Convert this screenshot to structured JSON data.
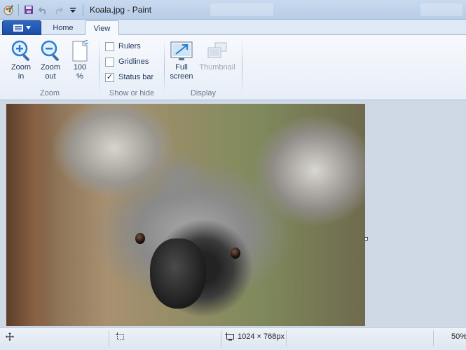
{
  "window": {
    "title": "Koala.jpg - Paint"
  },
  "tabs": {
    "home": "Home",
    "view": "View"
  },
  "ribbon": {
    "zoom": {
      "label": "Zoom",
      "zoom_in": "Zoom\nin",
      "zoom_out": "Zoom\nout",
      "hundred": "100\n%"
    },
    "show_or_hide": {
      "label": "Show or hide",
      "rulers": "Rulers",
      "gridlines": "Gridlines",
      "status_bar": "Status bar",
      "rulers_checked": false,
      "gridlines_checked": false,
      "status_bar_checked": true
    },
    "display": {
      "label": "Display",
      "full_screen": "Full\nscreen",
      "thumbnail": "Thumbnail"
    }
  },
  "statusbar": {
    "image_size": "1024 × 768px",
    "zoom_level": "50%"
  },
  "colors": {
    "accent": "#1a4fa5",
    "ribbon_bg": "#f5f8fc",
    "canvas_bg": "#cfd9e6"
  }
}
